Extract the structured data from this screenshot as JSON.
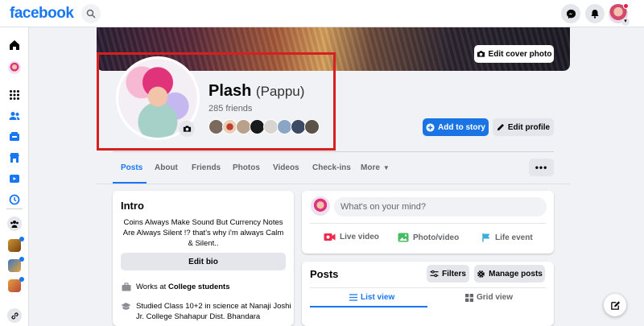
{
  "topbar": {
    "logo": "facebook",
    "icons": [
      "search-icon",
      "messenger-icon",
      "notifications-icon",
      "account-avatar"
    ],
    "brand_color": "#1877f2"
  },
  "rail": {
    "icons": [
      "home-icon",
      "profile-avatar",
      "menu-grid-icon",
      "friends-icon",
      "marketplace-icon",
      "store-icon",
      "watch-icon",
      "memories-icon",
      "groups-icon",
      "group-thumb-1",
      "group-thumb-2",
      "group-thumb-3",
      "link-icon"
    ]
  },
  "cover": {
    "edit_label": "Edit cover photo"
  },
  "profile": {
    "name": "Plash",
    "nickname": "(Pappu)",
    "friends": "285 friends",
    "add_story_label": "Add to story",
    "edit_profile_label": "Edit profile",
    "highlight_color": "#d81f1f"
  },
  "tabs": [
    {
      "label": "Posts"
    },
    {
      "label": "About"
    },
    {
      "label": "Friends"
    },
    {
      "label": "Photos"
    },
    {
      "label": "Videos"
    },
    {
      "label": "Check-ins"
    },
    {
      "label": "More"
    }
  ],
  "more_options": "•••",
  "intro": {
    "title": "Intro",
    "bio": "Coins Always Make Sound But Currency Notes Are Always Silent !? that's why i'm always Calm & Silent..",
    "edit_bio_label": "Edit bio",
    "work_prefix": "Works at",
    "work_place": "College students",
    "education_prefix": "Studied Class 10+2 in science at",
    "education_place": "Nanaji Joshi Jr. College Shahapur Dist. Bhandara"
  },
  "composer": {
    "placeholder": "What's on your mind?",
    "live_label": "Live video",
    "photo_label": "Photo/video",
    "event_label": "Life event"
  },
  "posts": {
    "title": "Posts",
    "filters_label": "Filters",
    "manage_label": "Manage posts",
    "list_view_label": "List view",
    "grid_view_label": "Grid view"
  }
}
